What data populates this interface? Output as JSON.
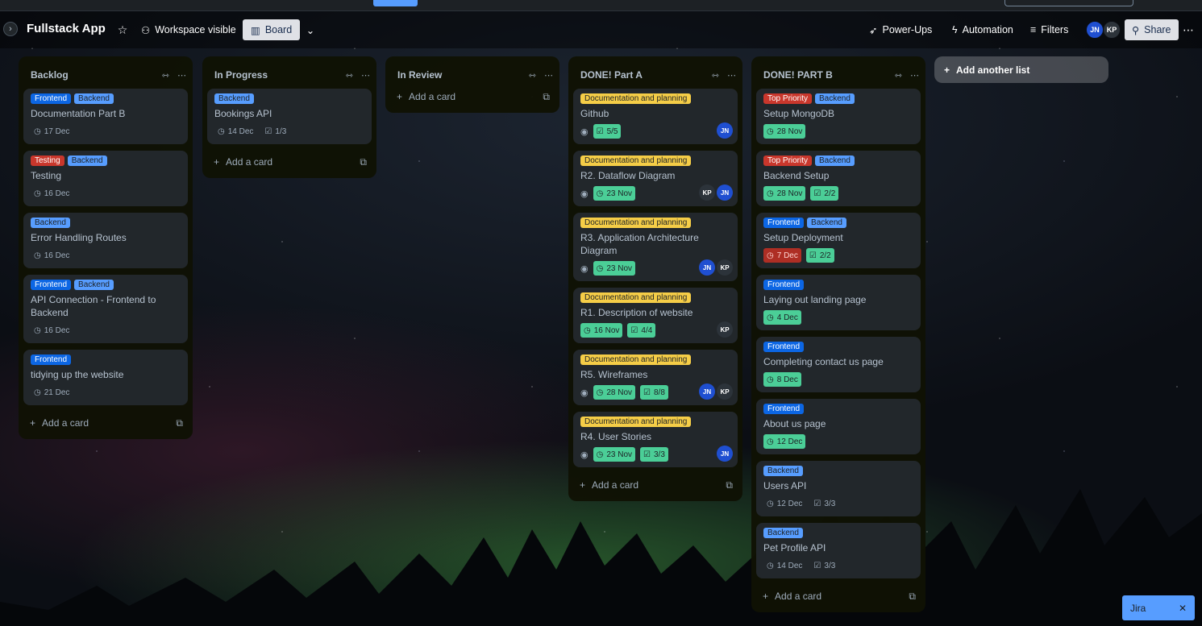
{
  "board": {
    "title": "Fullstack App",
    "visibility": "Workspace visible",
    "view": "Board",
    "powerups": "Power-Ups",
    "automation": "Automation",
    "filters": "Filters",
    "share": "Share",
    "members": [
      "JN",
      "KP"
    ]
  },
  "add_another_list": "Add another list",
  "add_card_label": "Add a card",
  "jira": "Jira",
  "colors": {
    "frontend": "#0c66e4",
    "backend": "#579dff",
    "red": "#c9372c",
    "doc": "#f5cd47",
    "due_green": "#4bce97"
  },
  "lists": [
    {
      "title": "Backlog",
      "cards": [
        {
          "labels": [
            {
              "text": "Frontend",
              "kind": "frontend"
            },
            {
              "text": "Backend",
              "kind": "backend"
            }
          ],
          "title": "Documentation Part B",
          "due": "17 Dec"
        },
        {
          "labels": [
            {
              "text": "Testing",
              "kind": "testing"
            },
            {
              "text": "Backend",
              "kind": "backend"
            }
          ],
          "title": "Testing",
          "due": "16 Dec"
        },
        {
          "labels": [
            {
              "text": "Backend",
              "kind": "backend"
            }
          ],
          "title": "Error Handling Routes",
          "due": "16 Dec"
        },
        {
          "labels": [
            {
              "text": "Frontend",
              "kind": "frontend"
            },
            {
              "text": "Backend",
              "kind": "backend"
            }
          ],
          "title": "API Connection - Frontend to Backend",
          "due": "16 Dec"
        },
        {
          "labels": [
            {
              "text": "Frontend",
              "kind": "frontend"
            }
          ],
          "title": "tidying up the website",
          "due": "21 Dec"
        }
      ]
    },
    {
      "title": "In Progress",
      "cards": [
        {
          "labels": [
            {
              "text": "Backend",
              "kind": "backend"
            }
          ],
          "title": "Bookings API",
          "due": "14 Dec",
          "checklist": "1/3"
        }
      ]
    },
    {
      "title": "In Review",
      "cards": []
    },
    {
      "title": "DONE! Part A",
      "cards": [
        {
          "labels": [
            {
              "text": "Documentation and planning",
              "kind": "doc"
            }
          ],
          "title": "Github",
          "watch": true,
          "checklist": "5/5",
          "checklist_done": true,
          "members": [
            "JN"
          ]
        },
        {
          "labels": [
            {
              "text": "Documentation and planning",
              "kind": "doc"
            }
          ],
          "title": "R2. Dataflow Diagram",
          "watch": true,
          "due": "23 Nov",
          "due_state": "done",
          "members": [
            "KP",
            "JN"
          ]
        },
        {
          "labels": [
            {
              "text": "Documentation and planning",
              "kind": "doc"
            }
          ],
          "title": "R3. Application Architecture Diagram",
          "watch": true,
          "due": "23 Nov",
          "due_state": "done",
          "members": [
            "JN",
            "KP"
          ]
        },
        {
          "labels": [
            {
              "text": "Documentation and planning",
              "kind": "doc"
            }
          ],
          "title": "R1. Description of website",
          "due": "16 Nov",
          "due_state": "done",
          "checklist": "4/4",
          "checklist_done": true,
          "members": [
            "KP"
          ]
        },
        {
          "labels": [
            {
              "text": "Documentation and planning",
              "kind": "doc"
            }
          ],
          "title": "R5. Wireframes",
          "watch": true,
          "due": "28 Nov",
          "due_state": "done",
          "checklist": "8/8",
          "checklist_done": true,
          "members": [
            "JN",
            "KP"
          ]
        },
        {
          "labels": [
            {
              "text": "Documentation and planning",
              "kind": "doc"
            }
          ],
          "title": "R4. User Stories",
          "watch": true,
          "due": "23 Nov",
          "due_state": "done",
          "checklist": "3/3",
          "checklist_done": true,
          "members": [
            "JN"
          ]
        }
      ]
    },
    {
      "title": "DONE! PART B",
      "cards": [
        {
          "labels": [
            {
              "text": "Top Priority",
              "kind": "toppriority"
            },
            {
              "text": "Backend",
              "kind": "backend"
            }
          ],
          "title": "Setup MongoDB",
          "due": "28 Nov",
          "due_state": "done"
        },
        {
          "labels": [
            {
              "text": "Top Priority",
              "kind": "toppriority"
            },
            {
              "text": "Backend",
              "kind": "backend"
            }
          ],
          "title": "Backend Setup",
          "due": "28 Nov",
          "due_state": "done",
          "checklist": "2/2",
          "checklist_done": true
        },
        {
          "labels": [
            {
              "text": "Frontend",
              "kind": "frontend"
            },
            {
              "text": "Backend",
              "kind": "backend"
            }
          ],
          "title": "Setup Deployment",
          "due": "7 Dec",
          "due_state": "overdue",
          "checklist": "2/2",
          "checklist_done": true
        },
        {
          "labels": [
            {
              "text": "Frontend",
              "kind": "frontend"
            }
          ],
          "title": "Laying out landing page",
          "due": "4 Dec",
          "due_state": "done"
        },
        {
          "labels": [
            {
              "text": "Frontend",
              "kind": "frontend"
            }
          ],
          "title": "Completing contact us page",
          "due": "8 Dec",
          "due_state": "done"
        },
        {
          "labels": [
            {
              "text": "Frontend",
              "kind": "frontend"
            }
          ],
          "title": "About us page",
          "due": "12 Dec",
          "due_state": "done"
        },
        {
          "labels": [
            {
              "text": "Backend",
              "kind": "backend"
            }
          ],
          "title": "Users API",
          "due": "12 Dec",
          "checklist": "3/3",
          "checklist_done": true
        },
        {
          "labels": [
            {
              "text": "Backend",
              "kind": "backend"
            }
          ],
          "title": "Pet Profile API",
          "due": "14 Dec",
          "checklist": "3/3",
          "checklist_done": true
        }
      ]
    }
  ]
}
